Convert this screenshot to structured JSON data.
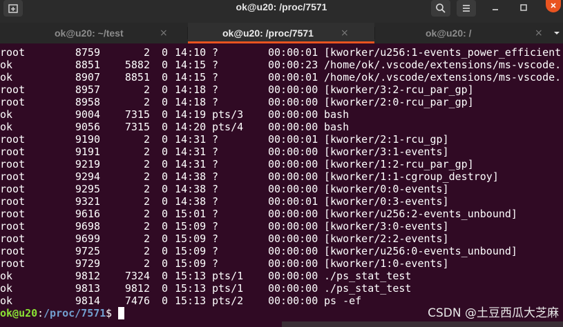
{
  "window": {
    "title": "ok@u20: /proc/7571"
  },
  "icons": {
    "new_tab": "new-tab-icon",
    "search": "search-icon",
    "menu": "hamburger-menu-icon",
    "minimize": "minimize-icon",
    "maximize": "maximize-icon",
    "close": "close-icon",
    "tab_list": "chevron-down-icon"
  },
  "colors": {
    "terminal_bg": "#300a24",
    "accent": "#e95420",
    "prompt_user": "#8ae234",
    "prompt_path": "#729fcf"
  },
  "tabs": [
    {
      "label": "ok@u20: ~/test",
      "active": false,
      "close": "×"
    },
    {
      "label": "ok@u20: /proc/7571",
      "active": true,
      "close": "×"
    },
    {
      "label": "ok@u20: /",
      "active": false,
      "close": "×"
    }
  ],
  "process_rows": [
    {
      "user": "root",
      "pid": "8759",
      "ppid": "2",
      "c": "0",
      "stime": "14:10",
      "tty": "?",
      "time": "00:00:01",
      "cmd": "[kworker/u256:1-events_power_efficient"
    },
    {
      "user": "ok",
      "pid": "8851",
      "ppid": "5882",
      "c": "0",
      "stime": "14:15",
      "tty": "?",
      "time": "00:00:23",
      "cmd": "/home/ok/.vscode/extensions/ms-vscode."
    },
    {
      "user": "ok",
      "pid": "8907",
      "ppid": "8851",
      "c": "0",
      "stime": "14:15",
      "tty": "?",
      "time": "00:00:01",
      "cmd": "/home/ok/.vscode/extensions/ms-vscode."
    },
    {
      "user": "root",
      "pid": "8957",
      "ppid": "2",
      "c": "0",
      "stime": "14:18",
      "tty": "?",
      "time": "00:00:00",
      "cmd": "[kworker/3:2-rcu_par_gp]"
    },
    {
      "user": "root",
      "pid": "8958",
      "ppid": "2",
      "c": "0",
      "stime": "14:18",
      "tty": "?",
      "time": "00:00:00",
      "cmd": "[kworker/2:0-rcu_par_gp]"
    },
    {
      "user": "ok",
      "pid": "9004",
      "ppid": "7315",
      "c": "0",
      "stime": "14:19",
      "tty": "pts/3",
      "time": "00:00:00",
      "cmd": "bash"
    },
    {
      "user": "ok",
      "pid": "9056",
      "ppid": "7315",
      "c": "0",
      "stime": "14:20",
      "tty": "pts/4",
      "time": "00:00:00",
      "cmd": "bash"
    },
    {
      "user": "root",
      "pid": "9190",
      "ppid": "2",
      "c": "0",
      "stime": "14:31",
      "tty": "?",
      "time": "00:00:01",
      "cmd": "[kworker/2:1-rcu_gp]"
    },
    {
      "user": "root",
      "pid": "9191",
      "ppid": "2",
      "c": "0",
      "stime": "14:31",
      "tty": "?",
      "time": "00:00:00",
      "cmd": "[kworker/3:1-events]"
    },
    {
      "user": "root",
      "pid": "9219",
      "ppid": "2",
      "c": "0",
      "stime": "14:31",
      "tty": "?",
      "time": "00:00:00",
      "cmd": "[kworker/1:2-rcu_par_gp]"
    },
    {
      "user": "root",
      "pid": "9294",
      "ppid": "2",
      "c": "0",
      "stime": "14:38",
      "tty": "?",
      "time": "00:00:00",
      "cmd": "[kworker/1:1-cgroup_destroy]"
    },
    {
      "user": "root",
      "pid": "9295",
      "ppid": "2",
      "c": "0",
      "stime": "14:38",
      "tty": "?",
      "time": "00:00:00",
      "cmd": "[kworker/0:0-events]"
    },
    {
      "user": "root",
      "pid": "9321",
      "ppid": "2",
      "c": "0",
      "stime": "14:38",
      "tty": "?",
      "time": "00:00:01",
      "cmd": "[kworker/0:3-events]"
    },
    {
      "user": "root",
      "pid": "9616",
      "ppid": "2",
      "c": "0",
      "stime": "15:01",
      "tty": "?",
      "time": "00:00:00",
      "cmd": "[kworker/u256:2-events_unbound]"
    },
    {
      "user": "root",
      "pid": "9698",
      "ppid": "2",
      "c": "0",
      "stime": "15:09",
      "tty": "?",
      "time": "00:00:00",
      "cmd": "[kworker/3:0-events]"
    },
    {
      "user": "root",
      "pid": "9699",
      "ppid": "2",
      "c": "0",
      "stime": "15:09",
      "tty": "?",
      "time": "00:00:00",
      "cmd": "[kworker/2:2-events]"
    },
    {
      "user": "root",
      "pid": "9725",
      "ppid": "2",
      "c": "0",
      "stime": "15:09",
      "tty": "?",
      "time": "00:00:00",
      "cmd": "[kworker/u256:0-events_unbound]"
    },
    {
      "user": "root",
      "pid": "9729",
      "ppid": "2",
      "c": "0",
      "stime": "15:09",
      "tty": "?",
      "time": "00:00:00",
      "cmd": "[kworker/1:0-events]"
    },
    {
      "user": "ok",
      "pid": "9812",
      "ppid": "7324",
      "c": "0",
      "stime": "15:13",
      "tty": "pts/1",
      "time": "00:00:00",
      "cmd": "./ps_stat_test"
    },
    {
      "user": "ok",
      "pid": "9813",
      "ppid": "9812",
      "c": "0",
      "stime": "15:13",
      "tty": "pts/1",
      "time": "00:00:00",
      "cmd": "./ps_stat_test"
    },
    {
      "user": "ok",
      "pid": "9814",
      "ppid": "7476",
      "c": "0",
      "stime": "15:13",
      "tty": "pts/2",
      "time": "00:00:00",
      "cmd": "ps -ef"
    }
  ],
  "prompt": {
    "user_host": "ok@u20",
    "separator": ":",
    "path": "/proc/7571",
    "symbol": "$ "
  },
  "watermark": "CSDN @土豆西瓜大芝麻"
}
